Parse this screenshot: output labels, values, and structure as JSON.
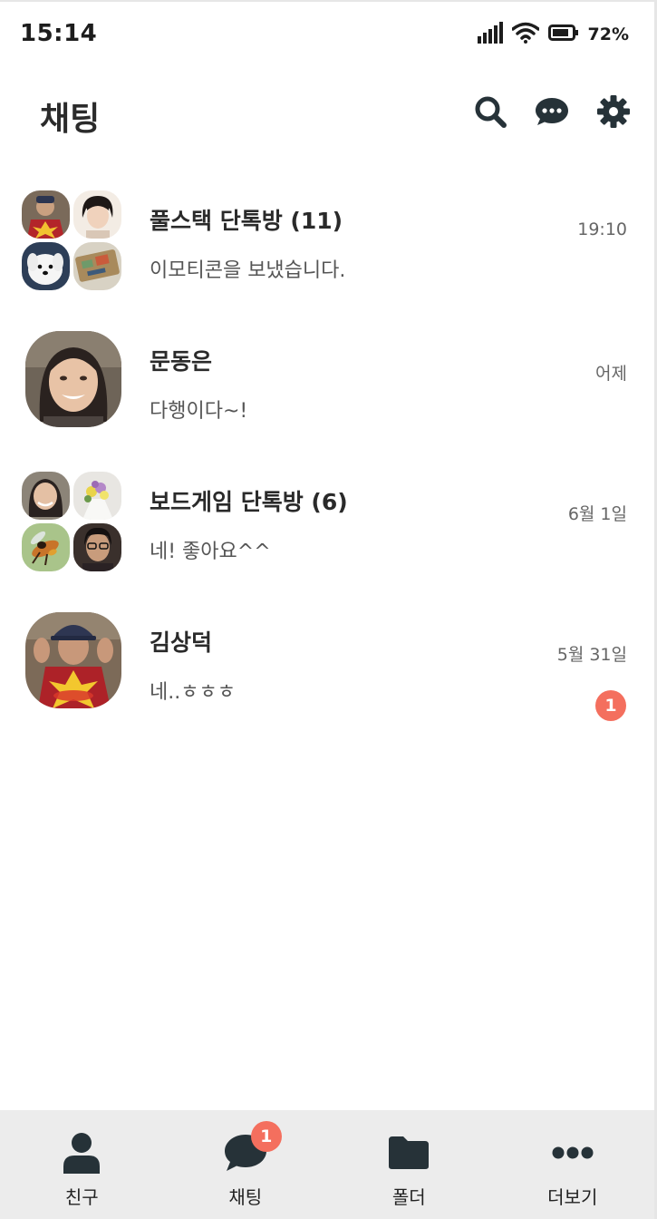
{
  "status_bar": {
    "time": "15:14",
    "battery_percent": "72%",
    "icons": [
      "signal-icon",
      "wifi-icon",
      "battery-icon"
    ]
  },
  "header": {
    "title": "채팅",
    "actions": [
      "search-icon",
      "new-chat-icon",
      "settings-icon"
    ]
  },
  "chats": [
    {
      "name": "풀스택 단톡방 (11)",
      "preview": "이모티콘을 보냈습니다.",
      "time": "19:10",
      "unread": ""
    },
    {
      "name": "문동은",
      "preview": "다행이다~!",
      "time": "어제",
      "unread": ""
    },
    {
      "name": "보드게임 단톡방 (6)",
      "preview": "네! 좋아요^^",
      "time": "6월 1일",
      "unread": ""
    },
    {
      "name": "김상덕",
      "preview": "네..ㅎㅎㅎ",
      "time": "5월 31일",
      "unread": "1"
    }
  ],
  "bottom_nav": [
    {
      "label": "친구",
      "icon": "person-icon",
      "badge": ""
    },
    {
      "label": "채팅",
      "icon": "chat-bubble-icon",
      "badge": "1"
    },
    {
      "label": "폴더",
      "icon": "folder-icon",
      "badge": ""
    },
    {
      "label": "더보기",
      "icon": "more-icon",
      "badge": ""
    }
  ],
  "colors": {
    "badge": "#f46f5e",
    "icon_dark": "#263238",
    "nav_background": "#ececec"
  }
}
